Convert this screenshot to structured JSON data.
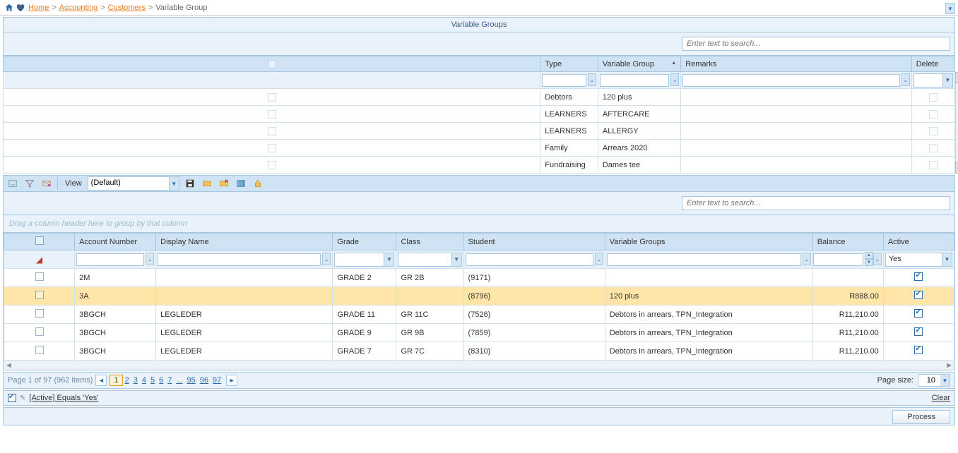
{
  "breadcrumb": {
    "home": "Home",
    "accounting": "Accounting",
    "customers": "Customers",
    "current": "Variable Group"
  },
  "panel_title": "Variable Groups",
  "search_placeholder": "Enter text to search...",
  "upper_columns": {
    "type": "Type",
    "variable_group": "Variable Group",
    "remarks": "Remarks",
    "delete": "Delete"
  },
  "upper_rows": [
    {
      "type": "Debtors",
      "vg": "120 plus"
    },
    {
      "type": "LEARNERS",
      "vg": "AFTERCARE"
    },
    {
      "type": "LEARNERS",
      "vg": "ALLERGY"
    },
    {
      "type": "Family",
      "vg": "Arrears 2020"
    },
    {
      "type": "Fundraising",
      "vg": "Dames tee"
    }
  ],
  "toolbar": {
    "view_label": "View",
    "view_value": "(Default)"
  },
  "group_panel_text": "Drag a column header here to group by that column",
  "lower_columns": {
    "account_number": "Account Number",
    "display_name": "Display Name",
    "grade": "Grade",
    "class": "Class",
    "student": "Student",
    "variable_groups": "Variable Groups",
    "balance": "Balance",
    "active": "Active"
  },
  "lower_filter_active": "Yes",
  "lower_rows": [
    {
      "acc": "2M",
      "name": "",
      "grade": "GRADE 2",
      "class": "GR 2B",
      "student": "(9171)",
      "vg": "",
      "balance": "",
      "active": true,
      "sel": false
    },
    {
      "acc": "3A",
      "name": "",
      "grade": "",
      "class": "",
      "student": "(8796)",
      "vg": "120 plus",
      "balance": "R888.00",
      "active": true,
      "sel": true
    },
    {
      "acc": "3BGCH",
      "name": "LEGLEDER",
      "grade": "GRADE 11",
      "class": "GR 11C",
      "student": "(7526)",
      "vg": "Debtors in arrears, TPN_Integration",
      "balance": "R11,210.00",
      "active": true,
      "sel": false
    },
    {
      "acc": "3BGCH",
      "name": "LEGLEDER",
      "grade": "GRADE 9",
      "class": "GR 9B",
      "student": "(7859)",
      "vg": "Debtors in arrears, TPN_Integration",
      "balance": "R11,210.00",
      "active": true,
      "sel": false
    },
    {
      "acc": "3BGCH",
      "name": "LEGLEDER",
      "grade": "GRADE 7",
      "class": "GR 7C",
      "student": "(8310)",
      "vg": "Debtors in arrears, TPN_Integration",
      "balance": "R11,210.00",
      "active": true,
      "sel": false
    }
  ],
  "pager": {
    "summary": "Page 1 of 97 (962 items)",
    "pages": [
      "1",
      "2",
      "3",
      "4",
      "5",
      "6",
      "7",
      "...",
      "95",
      "96",
      "97"
    ],
    "current": "1",
    "page_size_label": "Page size:",
    "page_size_value": "10"
  },
  "filter_bar": {
    "text": "[Active] Equals 'Yes'",
    "clear": "Clear"
  },
  "process_label": "Process"
}
